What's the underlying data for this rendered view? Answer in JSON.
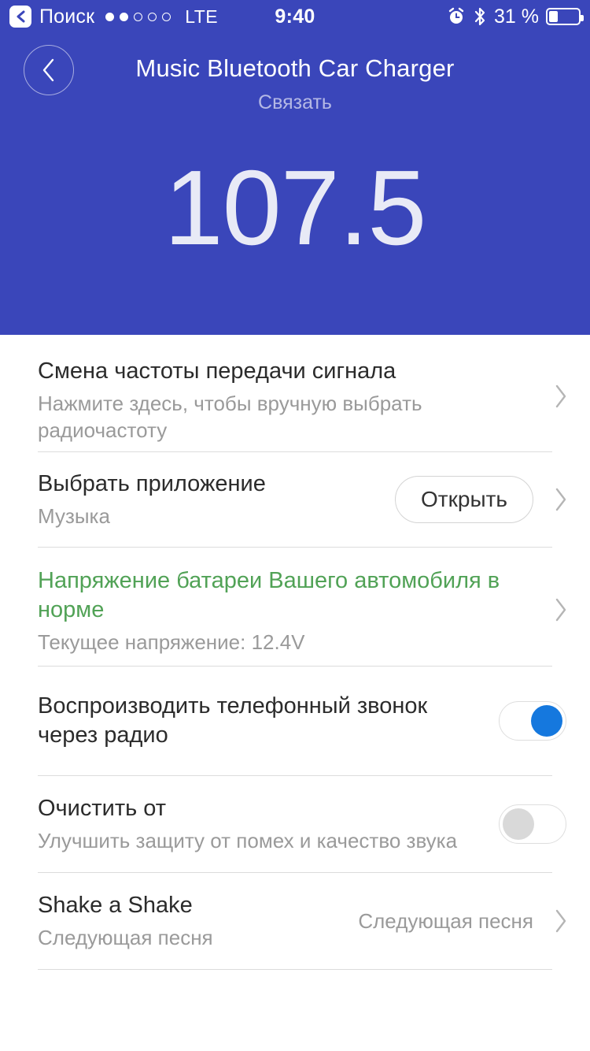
{
  "status_bar": {
    "back_badge_icon": "chevron-left-icon",
    "carrier": "Поиск",
    "signal_dots_filled": 2,
    "signal_dots_total": 5,
    "network": "LTE",
    "time": "9:40",
    "alarm_icon": "alarm-clock-icon",
    "bluetooth_icon": "bluetooth-icon",
    "battery_percent_label": "31 %",
    "battery_level": 31
  },
  "header": {
    "back_icon": "chevron-left-icon",
    "title": "Music Bluetooth Car Charger",
    "subtitle": "Связать",
    "frequency": "107.5",
    "background_color": "#3a46ba"
  },
  "list": {
    "rows": [
      {
        "title": "Смена частоты передачи сигнала",
        "subtitle": "Нажмите здесь, чтобы вручную выбрать радиочастоту",
        "accessory": "chevron"
      },
      {
        "title": "Выбрать приложение",
        "subtitle": "Музыка",
        "button_label": "Открыть",
        "accessory": "chevron"
      },
      {
        "title": "Напряжение батареи Вашего автомобиля в норме",
        "subtitle": "Текущее напряжение: 12.4V",
        "title_color": "#51a256",
        "accessory": "chevron"
      },
      {
        "title": "Воспроизводить телефонный звонок через радио",
        "toggle": "on",
        "accessory": "toggle"
      },
      {
        "title": "Очистить от",
        "subtitle": "Улучшить защиту от помех и качество звука",
        "toggle": "off",
        "accessory": "toggle"
      },
      {
        "title": "Shake a Shake",
        "subtitle": "Следующая песня",
        "value": "Следующая песня",
        "accessory": "chevron"
      }
    ]
  },
  "colors": {
    "accent_blue": "#3a46ba",
    "toggle_on": "#1578de",
    "toggle_off": "#d9d9d9",
    "status_green": "#51a256",
    "divider": "#dcdcdc"
  }
}
